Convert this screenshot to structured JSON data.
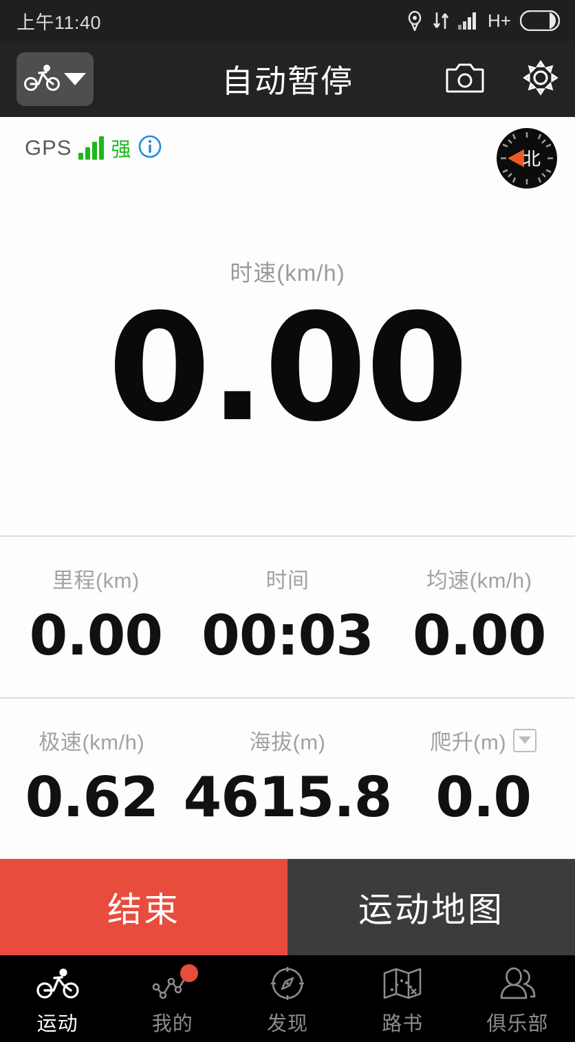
{
  "statusbar": {
    "time": "上午11:40",
    "network_type": "H+",
    "icons": [
      "location-icon",
      "data-transfer-icon",
      "signal-icon",
      "battery-icon"
    ]
  },
  "header": {
    "title": "自动暂停",
    "sport_selector_icon": "cycling-icon",
    "camera_icon": "camera-icon",
    "settings_icon": "gear-icon"
  },
  "gps": {
    "label": "GPS",
    "strength_text": "强",
    "bars": 4,
    "info_icon": "info-icon",
    "signal_color": "#1db81d",
    "info_color": "#1e88e5"
  },
  "compass": {
    "north_label": "北",
    "needle_color": "#f05a28"
  },
  "speed": {
    "label": "时速(km/h)",
    "value": "0.00"
  },
  "stats_rows": [
    [
      {
        "label": "里程(km)",
        "value": "0.00",
        "has_dropdown": false
      },
      {
        "label": "时间",
        "value": "00:03",
        "has_dropdown": false
      },
      {
        "label": "均速(km/h)",
        "value": "0.00",
        "has_dropdown": false
      }
    ],
    [
      {
        "label": "极速(km/h)",
        "value": "0.62",
        "has_dropdown": false
      },
      {
        "label": "海拔(m)",
        "value": "4615.8",
        "has_dropdown": false
      },
      {
        "label": "爬升(m)",
        "value": "0.0",
        "has_dropdown": true
      }
    ]
  ],
  "actions": {
    "end_label": "结束",
    "map_label": "运动地图",
    "end_color": "#e84c3d",
    "map_color": "#3c3c3c"
  },
  "bottom_nav": {
    "items": [
      {
        "label": "运动",
        "icon": "cycling-icon",
        "active": true,
        "badge": false
      },
      {
        "label": "我的",
        "icon": "line-chart-icon",
        "active": false,
        "badge": true
      },
      {
        "label": "发现",
        "icon": "compass-icon",
        "active": false,
        "badge": false
      },
      {
        "label": "路书",
        "icon": "map-icon",
        "active": false,
        "badge": false
      },
      {
        "label": "俱乐部",
        "icon": "people-icon",
        "active": false,
        "badge": false
      }
    ]
  }
}
